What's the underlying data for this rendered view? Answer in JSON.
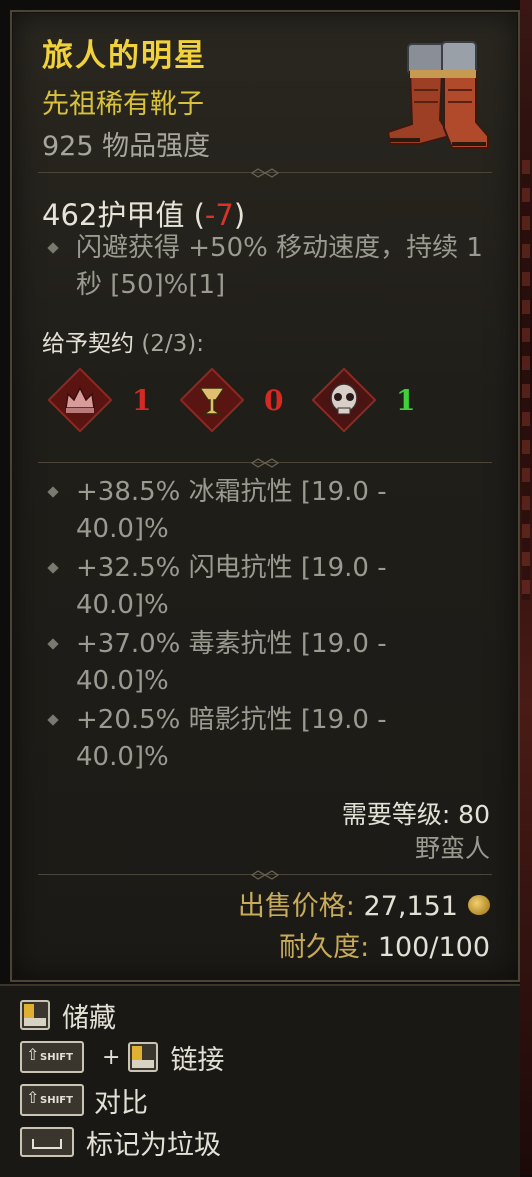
{
  "item": {
    "name": "旅人的明星",
    "rarity_type": "先祖稀有靴子",
    "item_power": "925 物品强度",
    "armor_value": "462护甲值",
    "armor_open": " (",
    "armor_delta": "-7",
    "armor_close": ")",
    "implicit": "闪避获得 +50% 移动速度，持续 1 秒 [50]%[1]",
    "pact_label": "给予契约",
    "pact_count": "(2/3):",
    "pacts": [
      {
        "icon": "ferocity-pact-icon",
        "value": "1",
        "color": "#d42a22"
      },
      {
        "icon": "devotion-pact-icon",
        "value": "0",
        "color": "#d42a22"
      },
      {
        "icon": "eternity-pact-icon",
        "value": "1",
        "color": "#3fd13a"
      }
    ],
    "affixes": [
      "+38.5% 冰霜抗性 [19.0 - 40.0]%",
      "+32.5% 闪电抗性 [19.0 - 40.0]%",
      "+37.0% 毒素抗性 [19.0 - 40.0]%",
      "+20.5% 暗影抗性 [19.0 - 40.0]%"
    ],
    "required_level": "需要等级: 80",
    "class_requirement": "野蛮人",
    "sell_label": "出售价格:",
    "sell_value": "27,151",
    "durability_label": "耐久度:",
    "durability_value": "100/100"
  },
  "controls": {
    "stash": "储藏",
    "plus": "+",
    "link": "链接",
    "compare": "对比",
    "junk": "标记为垃圾",
    "shift_label": "SHIFT"
  },
  "colors": {
    "title": "#f1d23c",
    "rarity": "#d9c23a",
    "negative": "#d8332a",
    "positive": "#3fd13a"
  }
}
